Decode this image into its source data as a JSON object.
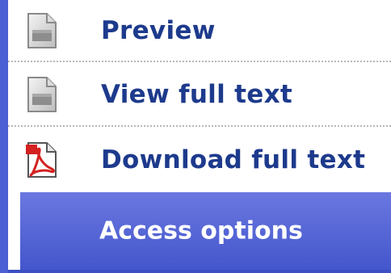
{
  "menu": {
    "items": [
      {
        "label": "Preview",
        "icon": "document-preview-icon"
      },
      {
        "label": "View full text",
        "icon": "document-view-icon"
      },
      {
        "label": "Download full text",
        "icon": "pdf-icon"
      }
    ],
    "access_label": "Access options"
  },
  "colors": {
    "rail": "#4a5fd3",
    "label_text": "#1d3a8c",
    "access_bar": "#4456cc",
    "separator": "#b8b8b8"
  }
}
